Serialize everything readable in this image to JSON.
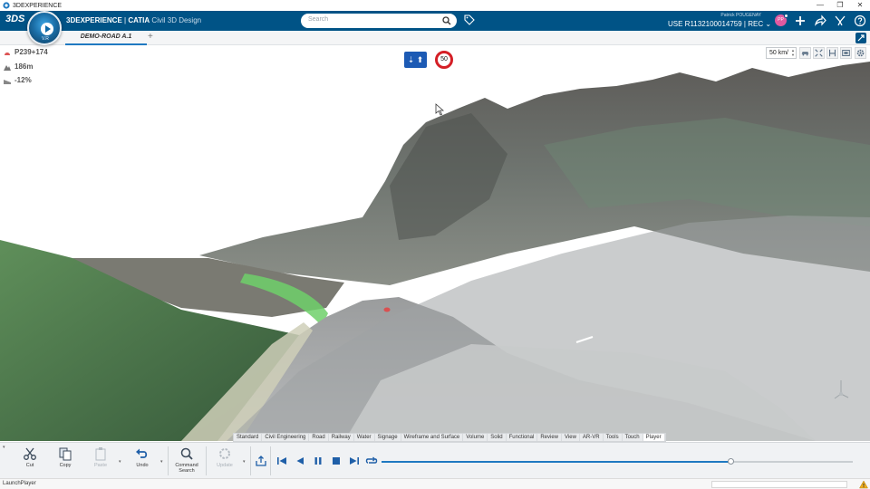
{
  "window": {
    "title": "3DEXPERIENCE",
    "controls": [
      "—",
      "❐",
      "✕"
    ]
  },
  "topbar": {
    "brand_strong": "3DEXPERIENCE",
    "brand_sep": " | ",
    "brand_app": "CATIA",
    "brand_sub": " Civil 3D Design",
    "compass_version": "V.R",
    "search_placeholder": "Search",
    "user_name": "Patrick POUGENAY",
    "user_context": "USE R1132100014759 | REC",
    "avatar_initials": "PP",
    "icons": [
      "search-icon",
      "tag-icon",
      "add-icon",
      "share-icon",
      "tools-icon",
      "help-icon"
    ]
  },
  "tabs": {
    "active_label": "DEMO-ROAD A.1",
    "add_symbol": "+"
  },
  "viewport": {
    "station": "P239+174",
    "elevation": "186m",
    "slope": "-12%",
    "lane_sign": "⇣ ⬆",
    "speed_limit": "50",
    "speed_field_value": "50 km/",
    "spin_up": "▲",
    "spin_down": "▼"
  },
  "workbench_tabs": [
    "Standard",
    "Civil Engineering",
    "Road",
    "Railway",
    "Water",
    "Signage",
    "Wireframe and Surface",
    "Volume",
    "Solid",
    "Functional",
    "Review",
    "View",
    "AR-VR",
    "Tools",
    "Touch",
    "Player"
  ],
  "workbench_active": "Player",
  "actions": {
    "cut": "Cut",
    "copy": "Copy",
    "paste": "Paste",
    "undo": "Undo",
    "command_search_1": "Command",
    "command_search_2": "Search",
    "update": "Update",
    "caret": "▾"
  },
  "player": {
    "progress": 0.74
  },
  "status": {
    "text": "LaunchPlayer"
  },
  "colors": {
    "brand_blue": "#005386",
    "accent_blue": "#1f79c1",
    "speed_red": "#d41f26",
    "avatar_pink": "#e05aa0"
  }
}
